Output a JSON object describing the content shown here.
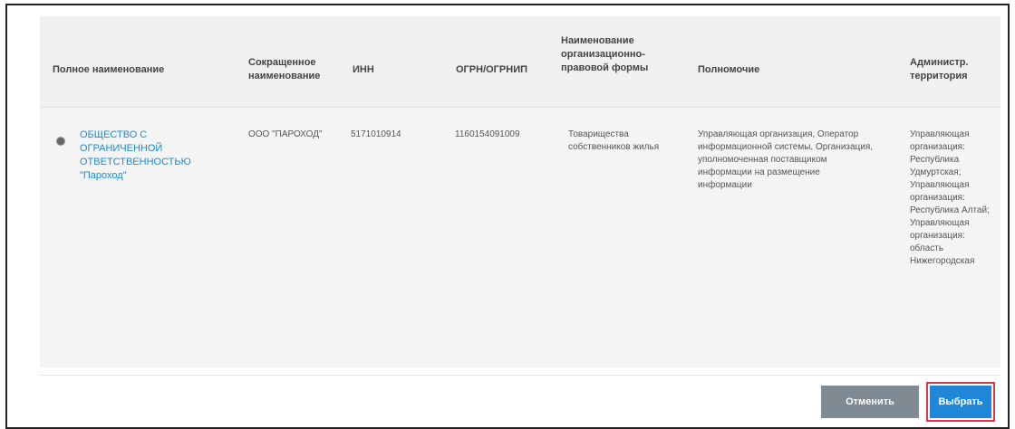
{
  "table": {
    "columns": [
      "Полное наименование",
      "Сокращенное наименование",
      "ИНН",
      "ОГРН/ОГРНИП",
      "Наименование организационно-правовой формы",
      "Полномочие",
      "Администр. территория"
    ],
    "row": {
      "full_name": "ОБЩЕСТВО С ОГРАНИЧЕННОЙ ОТВЕТСТВЕННОСТЬЮ \"Пароход\"",
      "short_name": "ООО \"ПАРОХОД\"",
      "inn": "5171010914",
      "ogrn": "1160154091009",
      "legal_form": "Товарищества собственников жилья",
      "authority": "Управляющая организация, Оператор информационной системы, Организация, уполномоченная поставщиком информации на размещение информации",
      "territory": "Управляющая организация: Республика Удмуртская; Управляющая организация: Республика Алтай; Управляющая организация: область Нижегородская"
    }
  },
  "buttons": {
    "cancel": "Отменить",
    "select": "Выбрать"
  }
}
